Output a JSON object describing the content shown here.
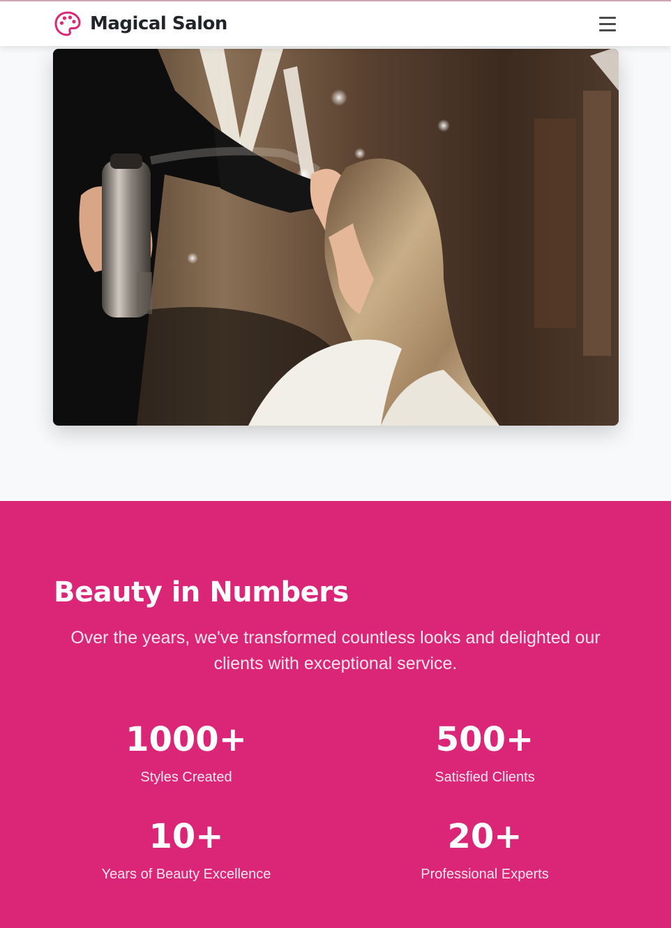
{
  "navbar": {
    "brand_name": "Magical Salon",
    "brand_icon": "palette-icon",
    "menu_icon": "hamburger-menu-icon"
  },
  "hero": {
    "image": "salon-hairstylist-photo"
  },
  "stats": {
    "title": "Beauty in Numbers",
    "description": "Over the years, we've transformed countless looks and delighted our clients with exceptional service.",
    "items": [
      {
        "number": "1000+",
        "label": "Styles Created"
      },
      {
        "number": "500+",
        "label": "Satisfied Clients"
      },
      {
        "number": "10+",
        "label": "Years of Beauty Excellence"
      },
      {
        "number": "20+",
        "label": "Professional Experts"
      }
    ]
  },
  "colors": {
    "accent": "#db2777",
    "stats_background": "#db2677",
    "brand_text": "#212529",
    "page_background": "#f8f9fa"
  }
}
